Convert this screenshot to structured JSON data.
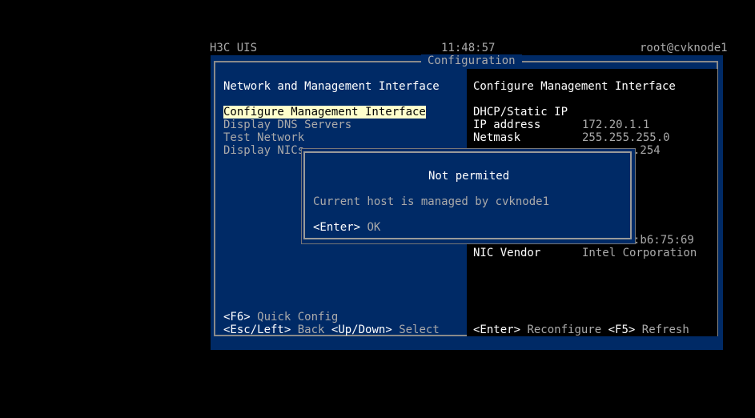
{
  "status_bar": {
    "product": "H3C UIS",
    "time": "11:48:57",
    "user_host": "root@cvknode1"
  },
  "window": {
    "title": "Configuration"
  },
  "left_panel": {
    "heading": "Network and Management Interface",
    "menu": [
      "Configure Management Interface",
      "Display DNS Servers",
      "Test Network",
      "Display NICs"
    ],
    "selected_index": 0
  },
  "right_panel": {
    "heading": "Configure Management Interface",
    "rows": [
      {
        "label": "DHCP/Static IP",
        "value": ""
      },
      {
        "label": "IP address",
        "value": "172.20.1.1"
      },
      {
        "label": "Netmask",
        "value": "255.255.255.0"
      }
    ],
    "partial_gateway": ".254",
    "partial_mac": ":b6:75:69",
    "nic_vendor_label": "NIC Vendor",
    "nic_vendor_value": "Intel Corporation"
  },
  "dialog": {
    "title": "Not permited",
    "message": "Current host is managed by cvknode1",
    "key": "<Enter>",
    "action": "OK"
  },
  "hints": {
    "f6_key": "<F6>",
    "f6_label": "Quick Config",
    "back_key": "<Esc/Left>",
    "back_label": "Back",
    "select_key": "<Up/Down>",
    "select_label": "Select",
    "enter_key": "<Enter>",
    "reconfigure_label": "Reconfigure",
    "refresh_key": "<F5>",
    "refresh_label": "Refresh"
  },
  "colors": {
    "background": "#000000",
    "window_blue": "#002a66",
    "highlight": "#ffffcc",
    "text_white": "#ffffff",
    "text_gray": "#aaaaaa"
  }
}
